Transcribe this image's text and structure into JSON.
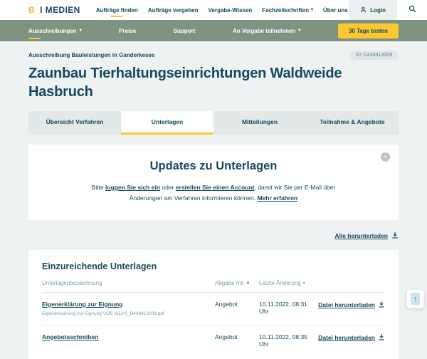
{
  "brand": {
    "logo_yellow": "B_",
    "logo_dark": "I MEDIEN"
  },
  "header": {
    "nav": [
      "Aufträge finden",
      "Aufträge vergeben",
      "Vergabe-Wissen",
      "Fachzeitschriften",
      "Über uns"
    ],
    "login_label": "Login"
  },
  "subnav": {
    "items": [
      "Ausschreibungen",
      "Preise",
      "Support",
      "An Vergabe teilnehmen"
    ],
    "cta_label": "30 Tage testen"
  },
  "page": {
    "breadcrumb": "Ausschreibung Bauleistungen in Ganderkesee",
    "id_badge": "ID: D448813009",
    "title": "Zaunbau Tierhaltungseinrichtungen Waldweide Hasbruch"
  },
  "tabs": [
    "Übersicht Verfahren",
    "Unterlagen",
    "Mitteilungen",
    "Teilnahme & Angebote"
  ],
  "updates_card": {
    "title": "Updates zu Unterlagen",
    "text_before": "Bitte ",
    "link_login": "loggen Sie sich ein",
    "text_mid1": " oder ",
    "link_account": "erstellen Sie einen Account",
    "text_mid2": ", damit wir Sie per E-Mail über Änderungen am Verfahren informieren können. ",
    "link_more": "Mehr erfahren"
  },
  "download_all_label": "Alle herunterladen",
  "documents_card": {
    "title": "Einzureichende Unterlagen",
    "columns": {
      "name": "Unterlagenbezeichnung",
      "submit_with": "Abgabe mit",
      "last_change": "Letzte Änderung"
    },
    "rows": [
      {
        "name": "Eigenerklärung zur Eignung",
        "file": "Eigenerklaerung zur Eignung VOB (e124)_D448813009.pdf",
        "submit_with": "Angebot",
        "last_change": "10.11.2022, 08:31 Uhr",
        "download_label": "Datei herunterladen"
      },
      {
        "name": "Angebotsschreiben",
        "file": "",
        "submit_with": "Angebot",
        "last_change": "10.11.2022, 08:35 Uhr",
        "download_label": "Datei herunterladen"
      }
    ]
  },
  "icons": {
    "caret_down": "▾",
    "sort_up": "▲",
    "sort_down": "▾",
    "close": "✕",
    "arrow_up": "↑"
  },
  "colors": {
    "brand_dark": "#17495e",
    "brand_yellow": "#fdc731",
    "subnav_green": "#7e9381",
    "page_bg": "#eff2f2",
    "muted_blue": "#7fa0af"
  }
}
